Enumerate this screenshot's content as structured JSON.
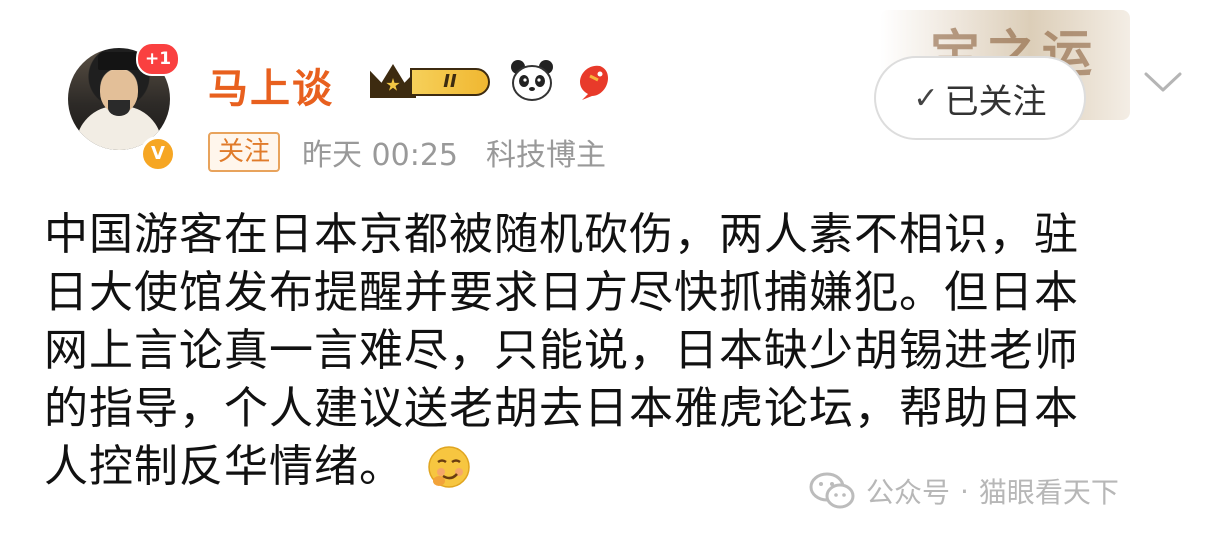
{
  "user": {
    "name": "马上谈",
    "notification_badge": "+1",
    "vip_level": "II",
    "verified_mark": "V",
    "follow_tag": "关注",
    "post_time": "昨天 00:25",
    "role": "科技博主"
  },
  "actions": {
    "banner_text": "宝之运",
    "followed_label": "已关注",
    "check_glyph": "✓"
  },
  "post": {
    "lines": [
      "中国游客在日本京都被随机砍伤，两人素不相识，驻",
      "日大使馆发布提醒并要求日方尽快抓捕嫌犯。但日本",
      "网上言论真一言难尽，只能说，日本缺少胡锡进老师",
      "的指导，个人建议送老胡去日本雅虎论坛，帮助日本",
      "人控制反华情绪。"
    ]
  },
  "watermark": {
    "label": "公众号",
    "separator": "·",
    "account": "猫眼看天下"
  },
  "colors": {
    "username": "#e8601e",
    "meta": "#999999",
    "badge_red": "#fa4040",
    "verified": "#f6a623"
  },
  "icons": [
    "avatar",
    "vip-crown-icon",
    "panda-icon",
    "koi-fish-icon",
    "check-icon",
    "chevron-down-icon",
    "smirk-emoji-icon",
    "wechat-icon"
  ]
}
